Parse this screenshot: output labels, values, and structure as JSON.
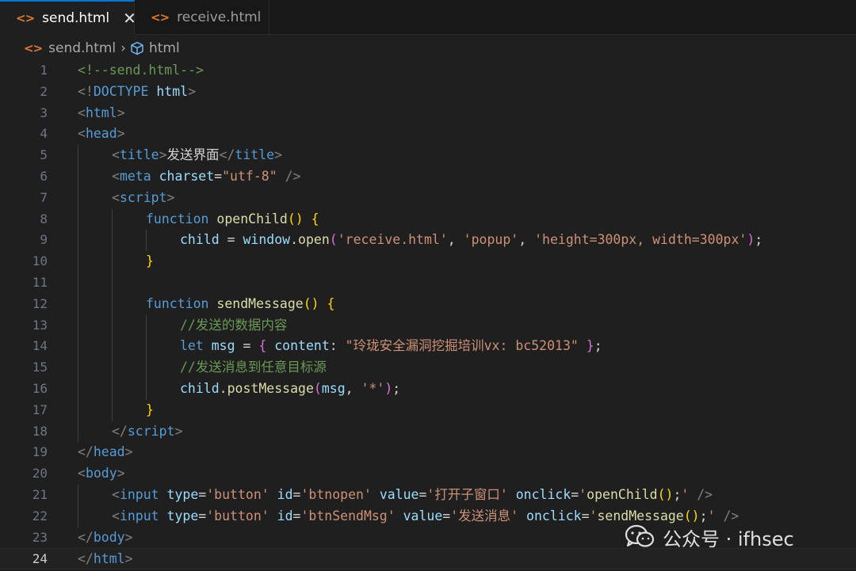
{
  "tabs": [
    {
      "label": "send.html",
      "active": true
    },
    {
      "label": "receive.html",
      "active": false
    }
  ],
  "breadcrumb": {
    "file": "send.html",
    "element": "html"
  },
  "icons": {
    "file": "html-file-icon",
    "close": "close-icon",
    "chevron": "chevron-right-icon",
    "element": "cube-icon"
  },
  "colors": {
    "accent": "#0078d4",
    "file_icon": "#e37933",
    "background": "#1f1f1f"
  },
  "current_line": 24,
  "lines": [
    {
      "n": "1",
      "indent": 0,
      "tokens": [
        [
          "com",
          "<!--send.html-->"
        ]
      ]
    },
    {
      "n": "2",
      "indent": 0,
      "tokens": [
        [
          "pun",
          "<!"
        ],
        [
          "tag",
          "DOCTYPE"
        ],
        [
          "txt",
          " "
        ],
        [
          "attr",
          "html"
        ],
        [
          "pun",
          ">"
        ]
      ]
    },
    {
      "n": "3",
      "indent": 0,
      "tokens": [
        [
          "pun",
          "<"
        ],
        [
          "tag",
          "html"
        ],
        [
          "pun",
          ">"
        ]
      ]
    },
    {
      "n": "4",
      "indent": 0,
      "tokens": [
        [
          "pun",
          "<"
        ],
        [
          "tag",
          "head"
        ],
        [
          "pun",
          ">"
        ]
      ]
    },
    {
      "n": "5",
      "indent": 1,
      "tokens": [
        [
          "pun",
          "<"
        ],
        [
          "tag",
          "title"
        ],
        [
          "pun",
          ">"
        ],
        [
          "txt",
          "发送界面"
        ],
        [
          "pun",
          "</"
        ],
        [
          "tag",
          "title"
        ],
        [
          "pun",
          ">"
        ]
      ]
    },
    {
      "n": "6",
      "indent": 1,
      "tokens": [
        [
          "pun",
          "<"
        ],
        [
          "tag",
          "meta"
        ],
        [
          "txt",
          " "
        ],
        [
          "attr",
          "charset"
        ],
        [
          "plain",
          "="
        ],
        [
          "str",
          "\"utf-8\""
        ],
        [
          "txt",
          " "
        ],
        [
          "pun",
          "/>"
        ]
      ]
    },
    {
      "n": "7",
      "indent": 1,
      "tokens": [
        [
          "pun",
          "<"
        ],
        [
          "tag",
          "script"
        ],
        [
          "pun",
          ">"
        ]
      ]
    },
    {
      "n": "8",
      "indent": 2,
      "tokens": [
        [
          "kw",
          "function"
        ],
        [
          "plain",
          " "
        ],
        [
          "fn",
          "openChild"
        ],
        [
          "b1",
          "()"
        ],
        [
          "plain",
          " "
        ],
        [
          "b1",
          "{"
        ]
      ]
    },
    {
      "n": "9",
      "indent": 3,
      "tokens": [
        [
          "var",
          "child"
        ],
        [
          "plain",
          " = "
        ],
        [
          "var",
          "window"
        ],
        [
          "plain",
          "."
        ],
        [
          "fn",
          "open"
        ],
        [
          "b2",
          "("
        ],
        [
          "str",
          "'receive.html'"
        ],
        [
          "plain",
          ", "
        ],
        [
          "str",
          "'popup'"
        ],
        [
          "plain",
          ", "
        ],
        [
          "str",
          "'height=300px, width=300px'"
        ],
        [
          "b2",
          ")"
        ],
        [
          "plain",
          ";"
        ]
      ]
    },
    {
      "n": "10",
      "indent": 2,
      "tokens": [
        [
          "b1",
          "}"
        ]
      ]
    },
    {
      "n": "11",
      "indent": 2,
      "tokens": []
    },
    {
      "n": "12",
      "indent": 2,
      "tokens": [
        [
          "kw",
          "function"
        ],
        [
          "plain",
          " "
        ],
        [
          "fn",
          "sendMessage"
        ],
        [
          "b1",
          "()"
        ],
        [
          "plain",
          " "
        ],
        [
          "b1",
          "{"
        ]
      ]
    },
    {
      "n": "13",
      "indent": 3,
      "tokens": [
        [
          "com",
          "//发送的数据内容"
        ]
      ]
    },
    {
      "n": "14",
      "indent": 3,
      "tokens": [
        [
          "kw",
          "let"
        ],
        [
          "plain",
          " "
        ],
        [
          "var",
          "msg"
        ],
        [
          "plain",
          " = "
        ],
        [
          "b2",
          "{"
        ],
        [
          "plain",
          " "
        ],
        [
          "var",
          "content"
        ],
        [
          "plain",
          ": "
        ],
        [
          "str",
          "\"玲珑安全漏洞挖掘培训vx: bc52013\""
        ],
        [
          "plain",
          " "
        ],
        [
          "b2",
          "}"
        ],
        [
          "plain",
          ";"
        ]
      ]
    },
    {
      "n": "15",
      "indent": 3,
      "tokens": [
        [
          "com",
          "//发送消息到任意目标源"
        ]
      ]
    },
    {
      "n": "16",
      "indent": 3,
      "tokens": [
        [
          "var",
          "child"
        ],
        [
          "plain",
          "."
        ],
        [
          "fn",
          "postMessage"
        ],
        [
          "b2",
          "("
        ],
        [
          "var",
          "msg"
        ],
        [
          "plain",
          ", "
        ],
        [
          "str",
          "'*'"
        ],
        [
          "b2",
          ")"
        ],
        [
          "plain",
          ";"
        ]
      ]
    },
    {
      "n": "17",
      "indent": 2,
      "tokens": [
        [
          "b1",
          "}"
        ]
      ]
    },
    {
      "n": "18",
      "indent": 1,
      "tokens": [
        [
          "pun",
          "</"
        ],
        [
          "tag",
          "script"
        ],
        [
          "pun",
          ">"
        ]
      ]
    },
    {
      "n": "19",
      "indent": 0,
      "tokens": [
        [
          "pun",
          "</"
        ],
        [
          "tag",
          "head"
        ],
        [
          "pun",
          ">"
        ]
      ]
    },
    {
      "n": "20",
      "indent": 0,
      "tokens": [
        [
          "pun",
          "<"
        ],
        [
          "tag",
          "body"
        ],
        [
          "pun",
          ">"
        ]
      ]
    },
    {
      "n": "21",
      "indent": 1,
      "tokens": [
        [
          "pun",
          "<"
        ],
        [
          "tag",
          "input"
        ],
        [
          "txt",
          " "
        ],
        [
          "attr",
          "type"
        ],
        [
          "plain",
          "="
        ],
        [
          "str",
          "'button'"
        ],
        [
          "txt",
          " "
        ],
        [
          "attr",
          "id"
        ],
        [
          "plain",
          "="
        ],
        [
          "str",
          "'btnopen'"
        ],
        [
          "txt",
          " "
        ],
        [
          "attr",
          "value"
        ],
        [
          "plain",
          "="
        ],
        [
          "str",
          "'打开子窗口'"
        ],
        [
          "txt",
          " "
        ],
        [
          "attr",
          "onclick"
        ],
        [
          "plain",
          "="
        ],
        [
          "str",
          "'"
        ],
        [
          "fn",
          "openChild"
        ],
        [
          "b1",
          "()"
        ],
        [
          "plain",
          ";"
        ],
        [
          "str",
          "'"
        ],
        [
          "txt",
          " "
        ],
        [
          "pun",
          "/>"
        ]
      ]
    },
    {
      "n": "22",
      "indent": 1,
      "tokens": [
        [
          "pun",
          "<"
        ],
        [
          "tag",
          "input"
        ],
        [
          "txt",
          " "
        ],
        [
          "attr",
          "type"
        ],
        [
          "plain",
          "="
        ],
        [
          "str",
          "'button'"
        ],
        [
          "txt",
          " "
        ],
        [
          "attr",
          "id"
        ],
        [
          "plain",
          "="
        ],
        [
          "str",
          "'btnSendMsg'"
        ],
        [
          "txt",
          " "
        ],
        [
          "attr",
          "value"
        ],
        [
          "plain",
          "="
        ],
        [
          "str",
          "'发送消息'"
        ],
        [
          "txt",
          " "
        ],
        [
          "attr",
          "onclick"
        ],
        [
          "plain",
          "="
        ],
        [
          "str",
          "'"
        ],
        [
          "fn",
          "sendMessage"
        ],
        [
          "b1",
          "()"
        ],
        [
          "plain",
          ";"
        ],
        [
          "str",
          "'"
        ],
        [
          "txt",
          " "
        ],
        [
          "pun",
          "/>"
        ]
      ]
    },
    {
      "n": "23",
      "indent": 0,
      "tokens": [
        [
          "pun",
          "</"
        ],
        [
          "tag",
          "body"
        ],
        [
          "pun",
          ">"
        ]
      ]
    },
    {
      "n": "24",
      "indent": 0,
      "tokens": [
        [
          "pun",
          "</"
        ],
        [
          "tag",
          "html"
        ],
        [
          "pun",
          ">"
        ]
      ]
    }
  ],
  "watermark": {
    "text": "公众号 · ifhsec",
    "icon": "wechat-icon"
  }
}
